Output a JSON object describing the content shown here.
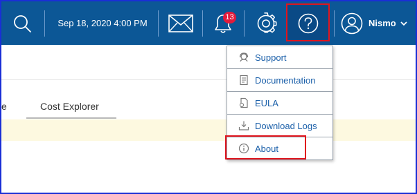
{
  "header": {
    "datetime": "Sep 18, 2020 4:00 PM",
    "notification_count": "13",
    "user_name": "Nismo"
  },
  "tabs": [
    {
      "label": "e"
    },
    {
      "label": "Cost Explorer"
    }
  ],
  "help_menu": {
    "items": [
      {
        "label": "Support",
        "icon": "support-headset-icon"
      },
      {
        "label": "Documentation",
        "icon": "document-icon"
      },
      {
        "label": "EULA",
        "icon": "eula-document-icon"
      },
      {
        "label": "Download Logs",
        "icon": "download-icon"
      },
      {
        "label": "About",
        "icon": "info-icon"
      }
    ]
  },
  "colors": {
    "topbar": "#0c5796",
    "highlight": "#e0141d",
    "link": "#1a5fa9",
    "badge": "#e21b3c",
    "notice": "#fdf9e0"
  }
}
